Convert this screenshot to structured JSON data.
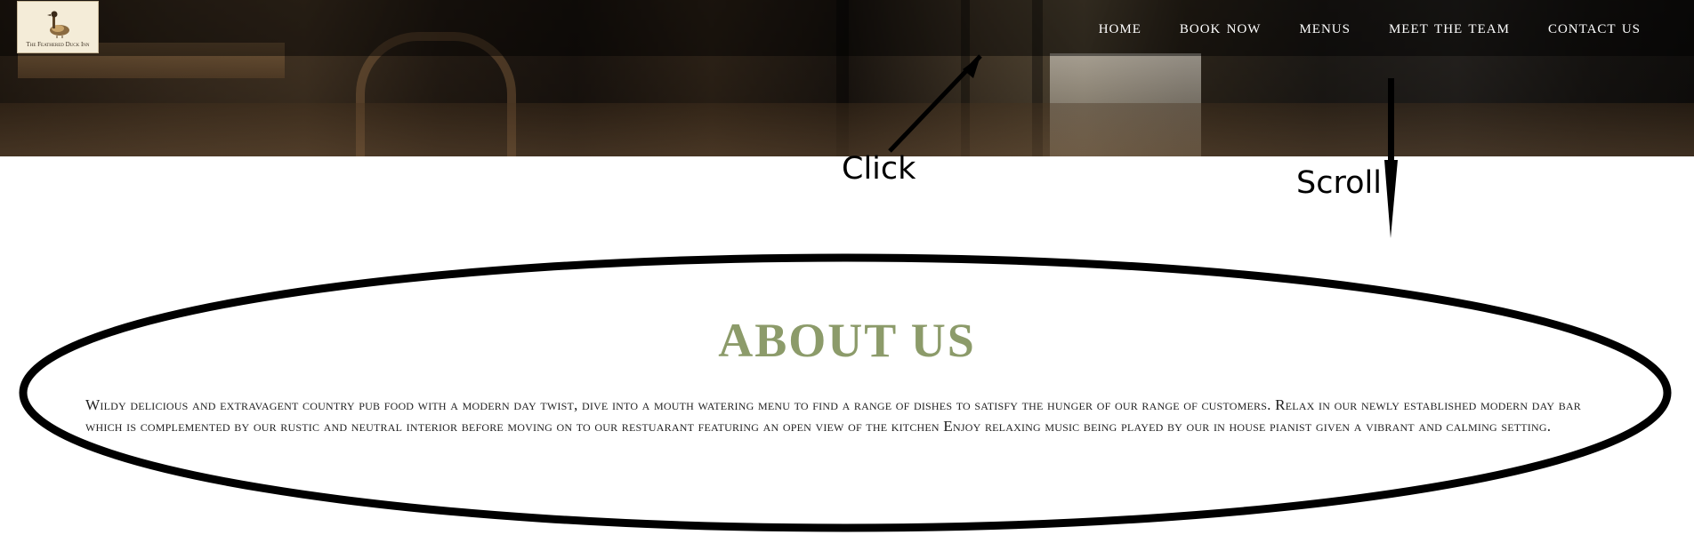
{
  "logo": {
    "name": "The Feathered Duck Inn"
  },
  "nav": {
    "items": [
      {
        "label": "HOME"
      },
      {
        "label": "BOOK NOW"
      },
      {
        "label": "MENUS"
      },
      {
        "label": "MEET THE TEAM"
      },
      {
        "label": "CONTACT US"
      }
    ]
  },
  "about": {
    "title": "ABOUT US",
    "body": "Wildy delicious and extravagent country pub food with a modern day twist, dive into a mouth watering menu to find a range of dishes to satisfy the hunger of our range of customers. Relax in our newly established modern day bar which is complemented by our rustic and neutral interior before moving on to our restuarant featuring an open view of the kitchen Enjoy relaxing music being played by our in house pianist given a vibrant and calming setting."
  },
  "annotations": {
    "click_label": "Click",
    "scroll_label": "Scroll"
  },
  "colors": {
    "accent_title": "#8c9b6a",
    "nav_text": "#ffffff",
    "annotation": "#000000"
  }
}
